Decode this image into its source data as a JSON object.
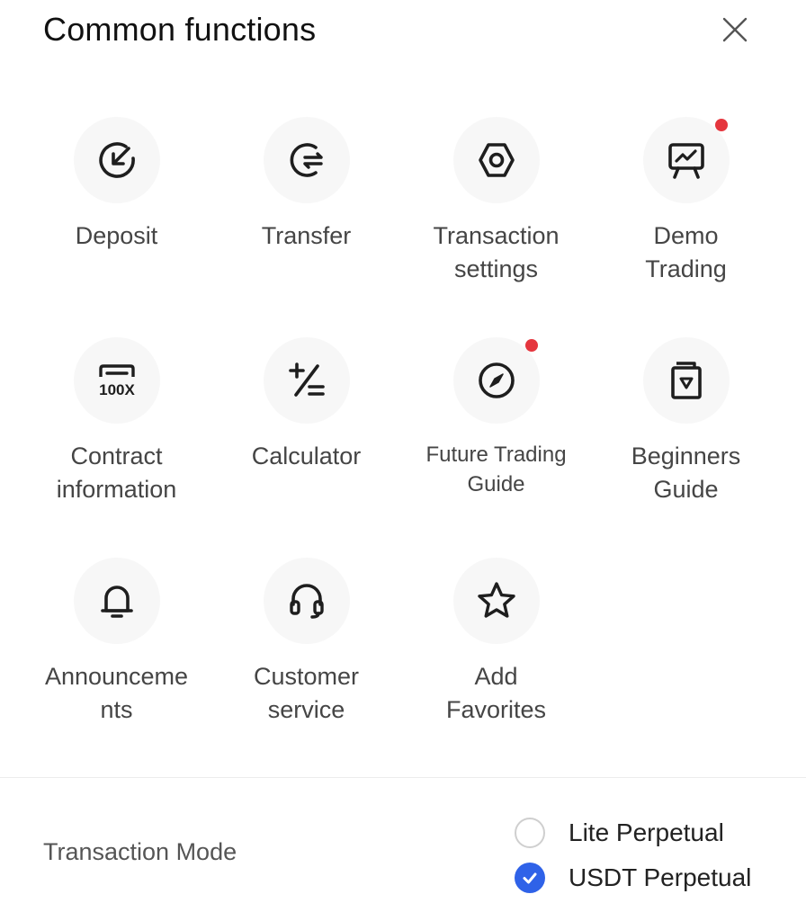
{
  "header": {
    "title": "Common functions"
  },
  "functions": [
    {
      "label": "Deposit",
      "icon": "deposit-icon",
      "dot": false
    },
    {
      "label": "Transfer",
      "icon": "transfer-icon",
      "dot": false
    },
    {
      "label": "Transaction\nsettings",
      "icon": "hexagon-settings-icon",
      "dot": false
    },
    {
      "label": "Demo\nTrading",
      "icon": "presentation-chart-icon",
      "dot": true
    },
    {
      "label": "Contract\ninformation",
      "icon": "leverage-100x-icon",
      "dot": false
    },
    {
      "label": "Calculator",
      "icon": "calculator-icon",
      "dot": false
    },
    {
      "label": "Future Trading\nGuide",
      "icon": "compass-icon",
      "dot": true
    },
    {
      "label": "Beginners\nGuide",
      "icon": "guide-book-icon",
      "dot": false
    },
    {
      "label": "Announceme\nnts",
      "icon": "bell-icon",
      "dot": false
    },
    {
      "label": "Customer\nservice",
      "icon": "headset-icon",
      "dot": false
    },
    {
      "label": "Add\nFavorites",
      "icon": "star-icon",
      "dot": false
    }
  ],
  "icon_text": {
    "leverage": "100X"
  },
  "transaction_mode": {
    "label": "Transaction Mode",
    "options": [
      {
        "label": "Lite Perpetual",
        "selected": false
      },
      {
        "label": "USDT Perpetual",
        "selected": true
      }
    ]
  },
  "colors": {
    "accent": "#2f62e8",
    "badge": "#e5363e",
    "icon_bg": "#f7f7f7"
  }
}
